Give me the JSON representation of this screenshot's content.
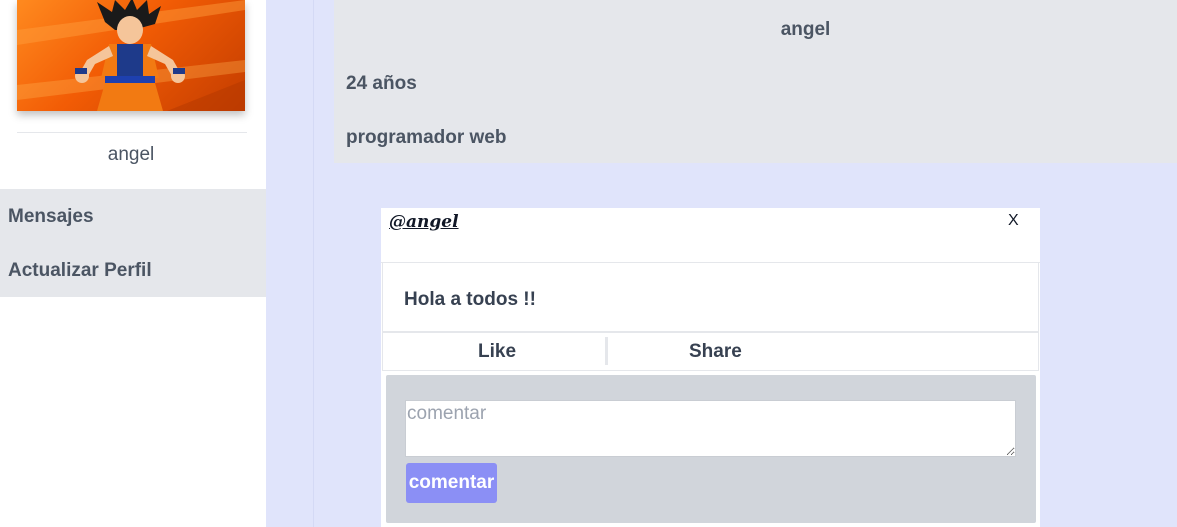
{
  "sidebar": {
    "username": "angel",
    "menu": [
      {
        "label": "Mensajes"
      },
      {
        "label": "Actualizar Perfil"
      }
    ]
  },
  "profile": {
    "name": "angel",
    "age": "24 años",
    "occupation": "programador web"
  },
  "post": {
    "author": "@angel",
    "close_label": "X",
    "text": "Hola a todos !!",
    "actions": {
      "like": "Like",
      "share": "Share"
    },
    "comment": {
      "placeholder": "comentar",
      "button_label": "comentar"
    }
  },
  "colors": {
    "page_background": "#e0e4fb",
    "card_gray": "#e5e7eb",
    "comment_area": "#d1d5db",
    "button_accent": "#8b8ff5"
  },
  "icons": {
    "avatar": "profile-avatar-image",
    "close": "close-x"
  }
}
